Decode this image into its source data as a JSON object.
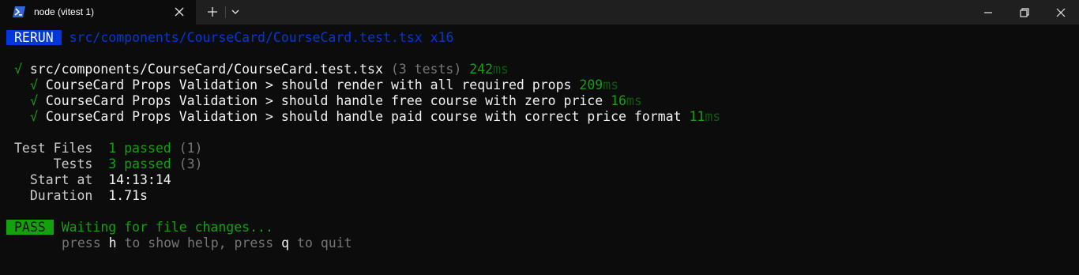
{
  "window": {
    "tab_title": "node (vitest 1)",
    "tab_icon": "powershell-icon",
    "accent": "#0037da",
    "pass_color": "#13a10e"
  },
  "terminal": {
    "rerun": {
      "badge": "RERUN",
      "path": "src/components/CourseCard/CourseCard.test.tsx",
      "count": "x16"
    },
    "file": {
      "check": "√",
      "path": "src/components/CourseCard/CourseCard.test.tsx",
      "tests": "(3 tests)",
      "time": "242",
      "unit": "ms"
    },
    "tests": [
      {
        "check": "√",
        "name": "CourseCard Props Validation > should render with all required props",
        "time": "209",
        "unit": "ms"
      },
      {
        "check": "√",
        "name": "CourseCard Props Validation > should handle free course with zero price",
        "time": "16",
        "unit": "ms"
      },
      {
        "check": "√",
        "name": "CourseCard Props Validation > should handle paid course with correct price format",
        "time": "11",
        "unit": "ms"
      }
    ],
    "summary": {
      "test_files": {
        "label": "Test Files",
        "value": "1 passed",
        "total": "(1)"
      },
      "tests": {
        "label": "Tests",
        "value": "3 passed",
        "total": "(3)"
      },
      "start_at": {
        "label": "Start at",
        "value": "14:13:14"
      },
      "duration": {
        "label": "Duration",
        "value": "1.71s"
      }
    },
    "status": {
      "badge": "PASS",
      "message": "Waiting for file changes...",
      "help": {
        "p1": "press ",
        "k1": "h",
        "p2": " to show help, press ",
        "k2": "q",
        "p3": " to quit"
      }
    }
  }
}
